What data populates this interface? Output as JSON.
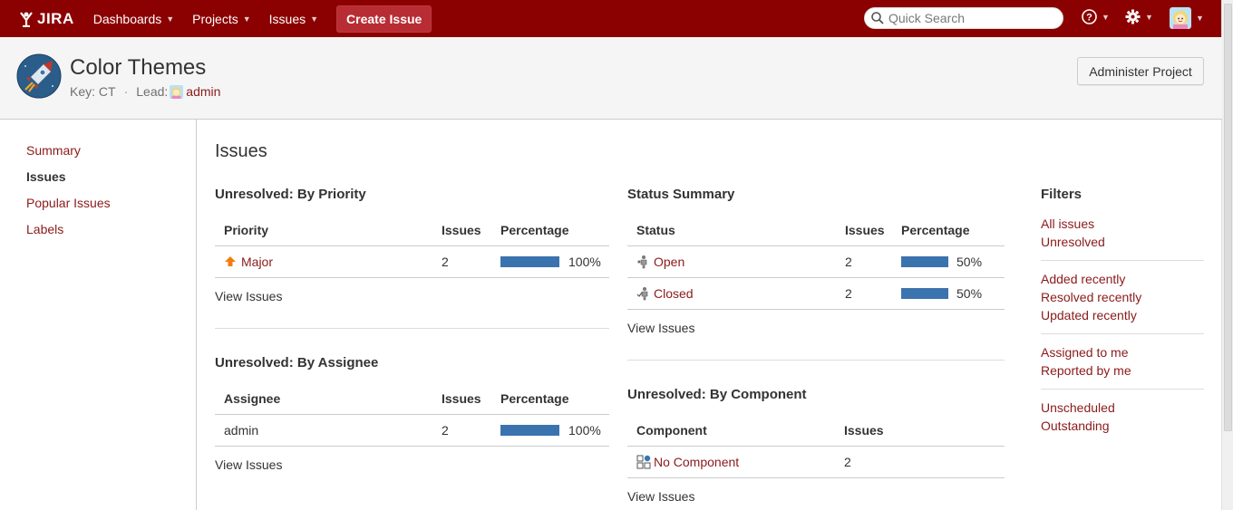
{
  "header": {
    "logo_text": "JIRA",
    "nav": [
      {
        "label": "Dashboards"
      },
      {
        "label": "Projects"
      },
      {
        "label": "Issues"
      }
    ],
    "create_label": "Create Issue",
    "search_placeholder": "Quick Search",
    "bg_color": "#8b0000"
  },
  "project": {
    "title": "Color Themes",
    "key_label": "Key: CT",
    "lead_label": "Lead:",
    "lead_name": "admin",
    "admin_button": "Administer Project"
  },
  "sidebar": {
    "items": [
      {
        "label": "Summary",
        "active": false
      },
      {
        "label": "Issues",
        "active": true
      },
      {
        "label": "Popular Issues",
        "active": false
      },
      {
        "label": "Labels",
        "active": false
      }
    ]
  },
  "main": {
    "title": "Issues",
    "by_priority": {
      "title": "Unresolved: By Priority",
      "columns": [
        "Priority",
        "Issues",
        "Percentage"
      ],
      "rows": [
        {
          "name": "Major",
          "count": "2",
          "pct": "100%",
          "fraction": 1.0
        }
      ],
      "view_link": "View Issues"
    },
    "by_assignee": {
      "title": "Unresolved: By Assignee",
      "columns": [
        "Assignee",
        "Issues",
        "Percentage"
      ],
      "rows": [
        {
          "name": "admin",
          "count": "2",
          "pct": "100%",
          "fraction": 1.0
        }
      ],
      "view_link": "View Issues"
    },
    "status_summary": {
      "title": "Status Summary",
      "columns": [
        "Status",
        "Issues",
        "Percentage"
      ],
      "rows": [
        {
          "name": "Open",
          "count": "2",
          "pct": "50%",
          "fraction": 0.5
        },
        {
          "name": "Closed",
          "count": "2",
          "pct": "50%",
          "fraction": 0.5
        }
      ],
      "view_link": "View Issues"
    },
    "by_component": {
      "title": "Unresolved: By Component",
      "columns": [
        "Component",
        "Issues"
      ],
      "rows": [
        {
          "name": "No Component",
          "count": "2"
        }
      ],
      "view_link": "View Issues"
    }
  },
  "filters": {
    "title": "Filters",
    "groups": [
      [
        "All issues",
        "Unresolved"
      ],
      [
        "Added recently",
        "Resolved recently",
        "Updated recently"
      ],
      [
        "Assigned to me",
        "Reported by me"
      ],
      [
        "Unscheduled",
        "Outstanding"
      ]
    ]
  },
  "colors": {
    "accent": "#8b1a1a",
    "bar": "#3b73af",
    "priority_major": "#f07d0f"
  }
}
